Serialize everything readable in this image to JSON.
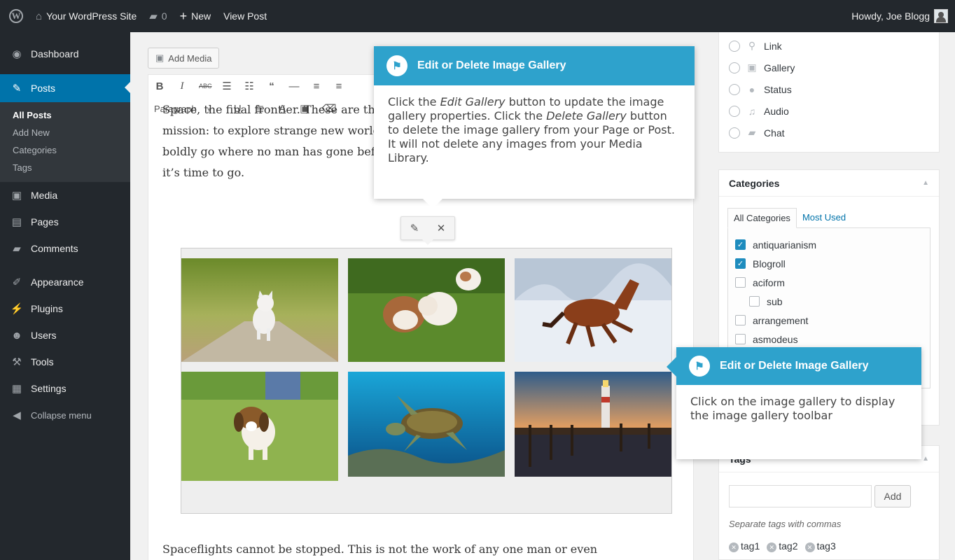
{
  "adminbar": {
    "site_name": "Your WordPress Site",
    "comments_count": "0",
    "new_label": "New",
    "view_post_label": "View Post",
    "howdy": "Howdy, Joe Blogg"
  },
  "menu": {
    "dashboard": "Dashboard",
    "posts": "Posts",
    "posts_sub": [
      "All Posts",
      "Add New",
      "Categories",
      "Tags"
    ],
    "media": "Media",
    "pages": "Pages",
    "comments": "Comments",
    "appearance": "Appearance",
    "plugins": "Plugins",
    "users": "Users",
    "tools": "Tools",
    "settings": "Settings",
    "collapse": "Collapse menu"
  },
  "editor": {
    "add_media": "Add Media",
    "format_select": "Paragraph",
    "para1": "Space, the final frontier. These are the voyages of the Starship Enterprise. Its five-year mission: to explore strange new worlds, to seek out new life and new civilizations, to boldly go where no man has gone before. We need to believe in what we’re doing. Now it’s time to go.",
    "para2": "Spaceflights cannot be stopped. This is not the work of any one man or even"
  },
  "gallery": {
    "images": [
      "kitten",
      "bulldog puppies",
      "horse in snow",
      "beagle puppy",
      "sea turtle",
      "lighthouse pier"
    ]
  },
  "sidebar": {
    "formats": [
      "Link",
      "Gallery",
      "Status",
      "Audio",
      "Chat"
    ],
    "categories_title": "Categories",
    "tab_all": "All Categories",
    "tab_used": "Most Used",
    "categories": [
      {
        "label": "antiquarianism",
        "checked": true
      },
      {
        "label": "Blogroll",
        "checked": true
      },
      {
        "label": "aciform",
        "checked": false
      },
      {
        "label": "sub",
        "checked": false
      },
      {
        "label": "arrangement",
        "checked": false
      },
      {
        "label": "asmodeus",
        "checked": false
      }
    ],
    "tags_title": "Tags",
    "tags_add": "Add",
    "tags_hint": "Separate tags with commas",
    "tags": [
      "tag1",
      "tag2",
      "tag3"
    ]
  },
  "tooltip1": {
    "title": "Edit or Delete Image Gallery",
    "body_a": "Click the ",
    "body_b": "Edit Gallery",
    "body_c": " button to update the image gallery properties. Click the ",
    "body_d": "Delete Gallery",
    "body_e": " button to delete the image gallery from your Page or Post. It will not delete any images from your Media Library."
  },
  "tooltip2": {
    "title": "Edit or Delete Image Gallery",
    "body": "Click on the image gallery to display the image gallery toolbar"
  },
  "colors": {
    "adminbar": "#23282d",
    "accent": "#0073aa",
    "tooltip": "#2ea2cc"
  }
}
